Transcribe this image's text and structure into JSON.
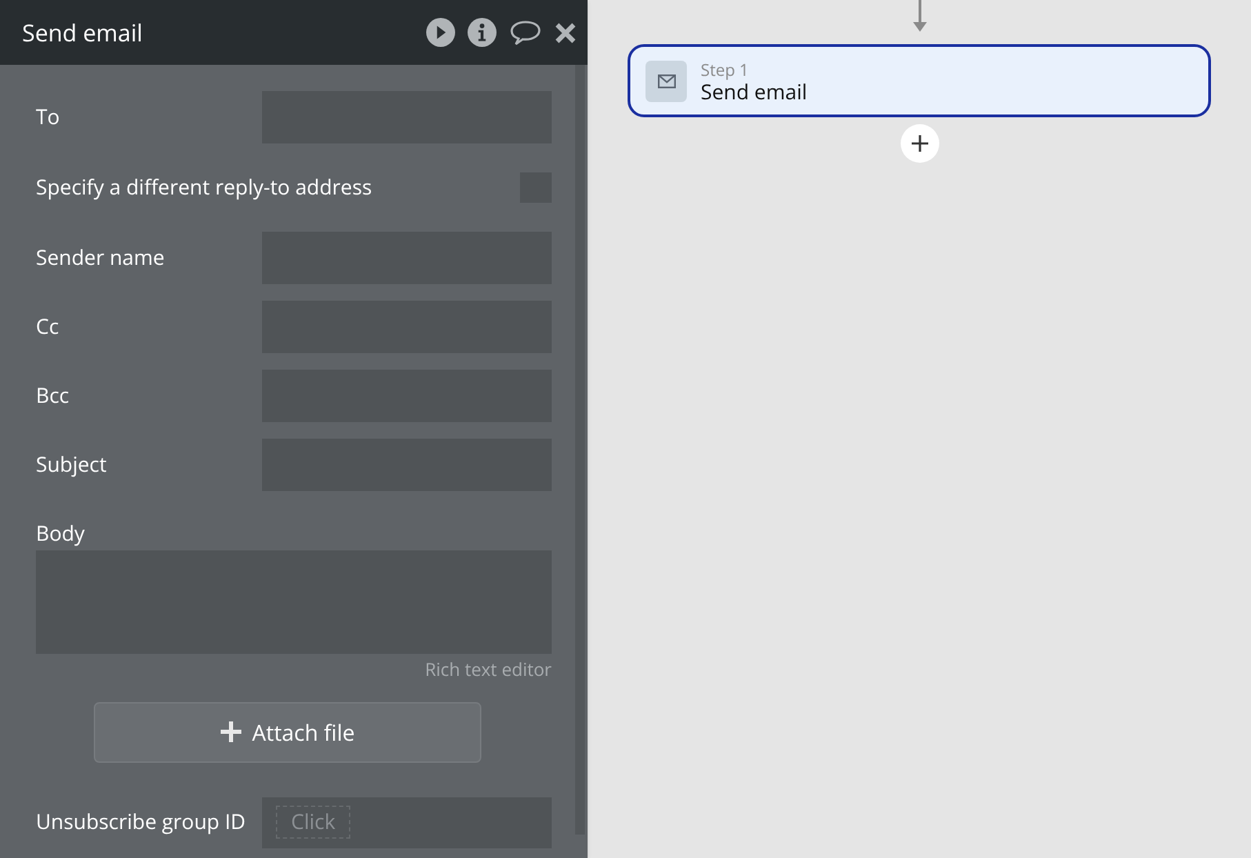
{
  "panel": {
    "title": "Send email",
    "fields": [
      {
        "kind": "text",
        "label": "To"
      },
      {
        "kind": "checkbox",
        "label": "Specify a different reply-to address",
        "checked": false
      },
      {
        "kind": "text",
        "label": "Sender name"
      },
      {
        "kind": "text",
        "label": "Cc"
      },
      {
        "kind": "text",
        "label": "Bcc"
      },
      {
        "kind": "text",
        "label": "Subject"
      }
    ],
    "body": {
      "label": "Body",
      "hint": "Rich text editor"
    },
    "attach_button": "Attach file",
    "unsubscribe": {
      "label": "Unsubscribe group ID",
      "placeholder": "Click"
    }
  },
  "workflow": {
    "steps": [
      {
        "step": "Step 1",
        "name": "Send email",
        "selected": true
      }
    ]
  }
}
